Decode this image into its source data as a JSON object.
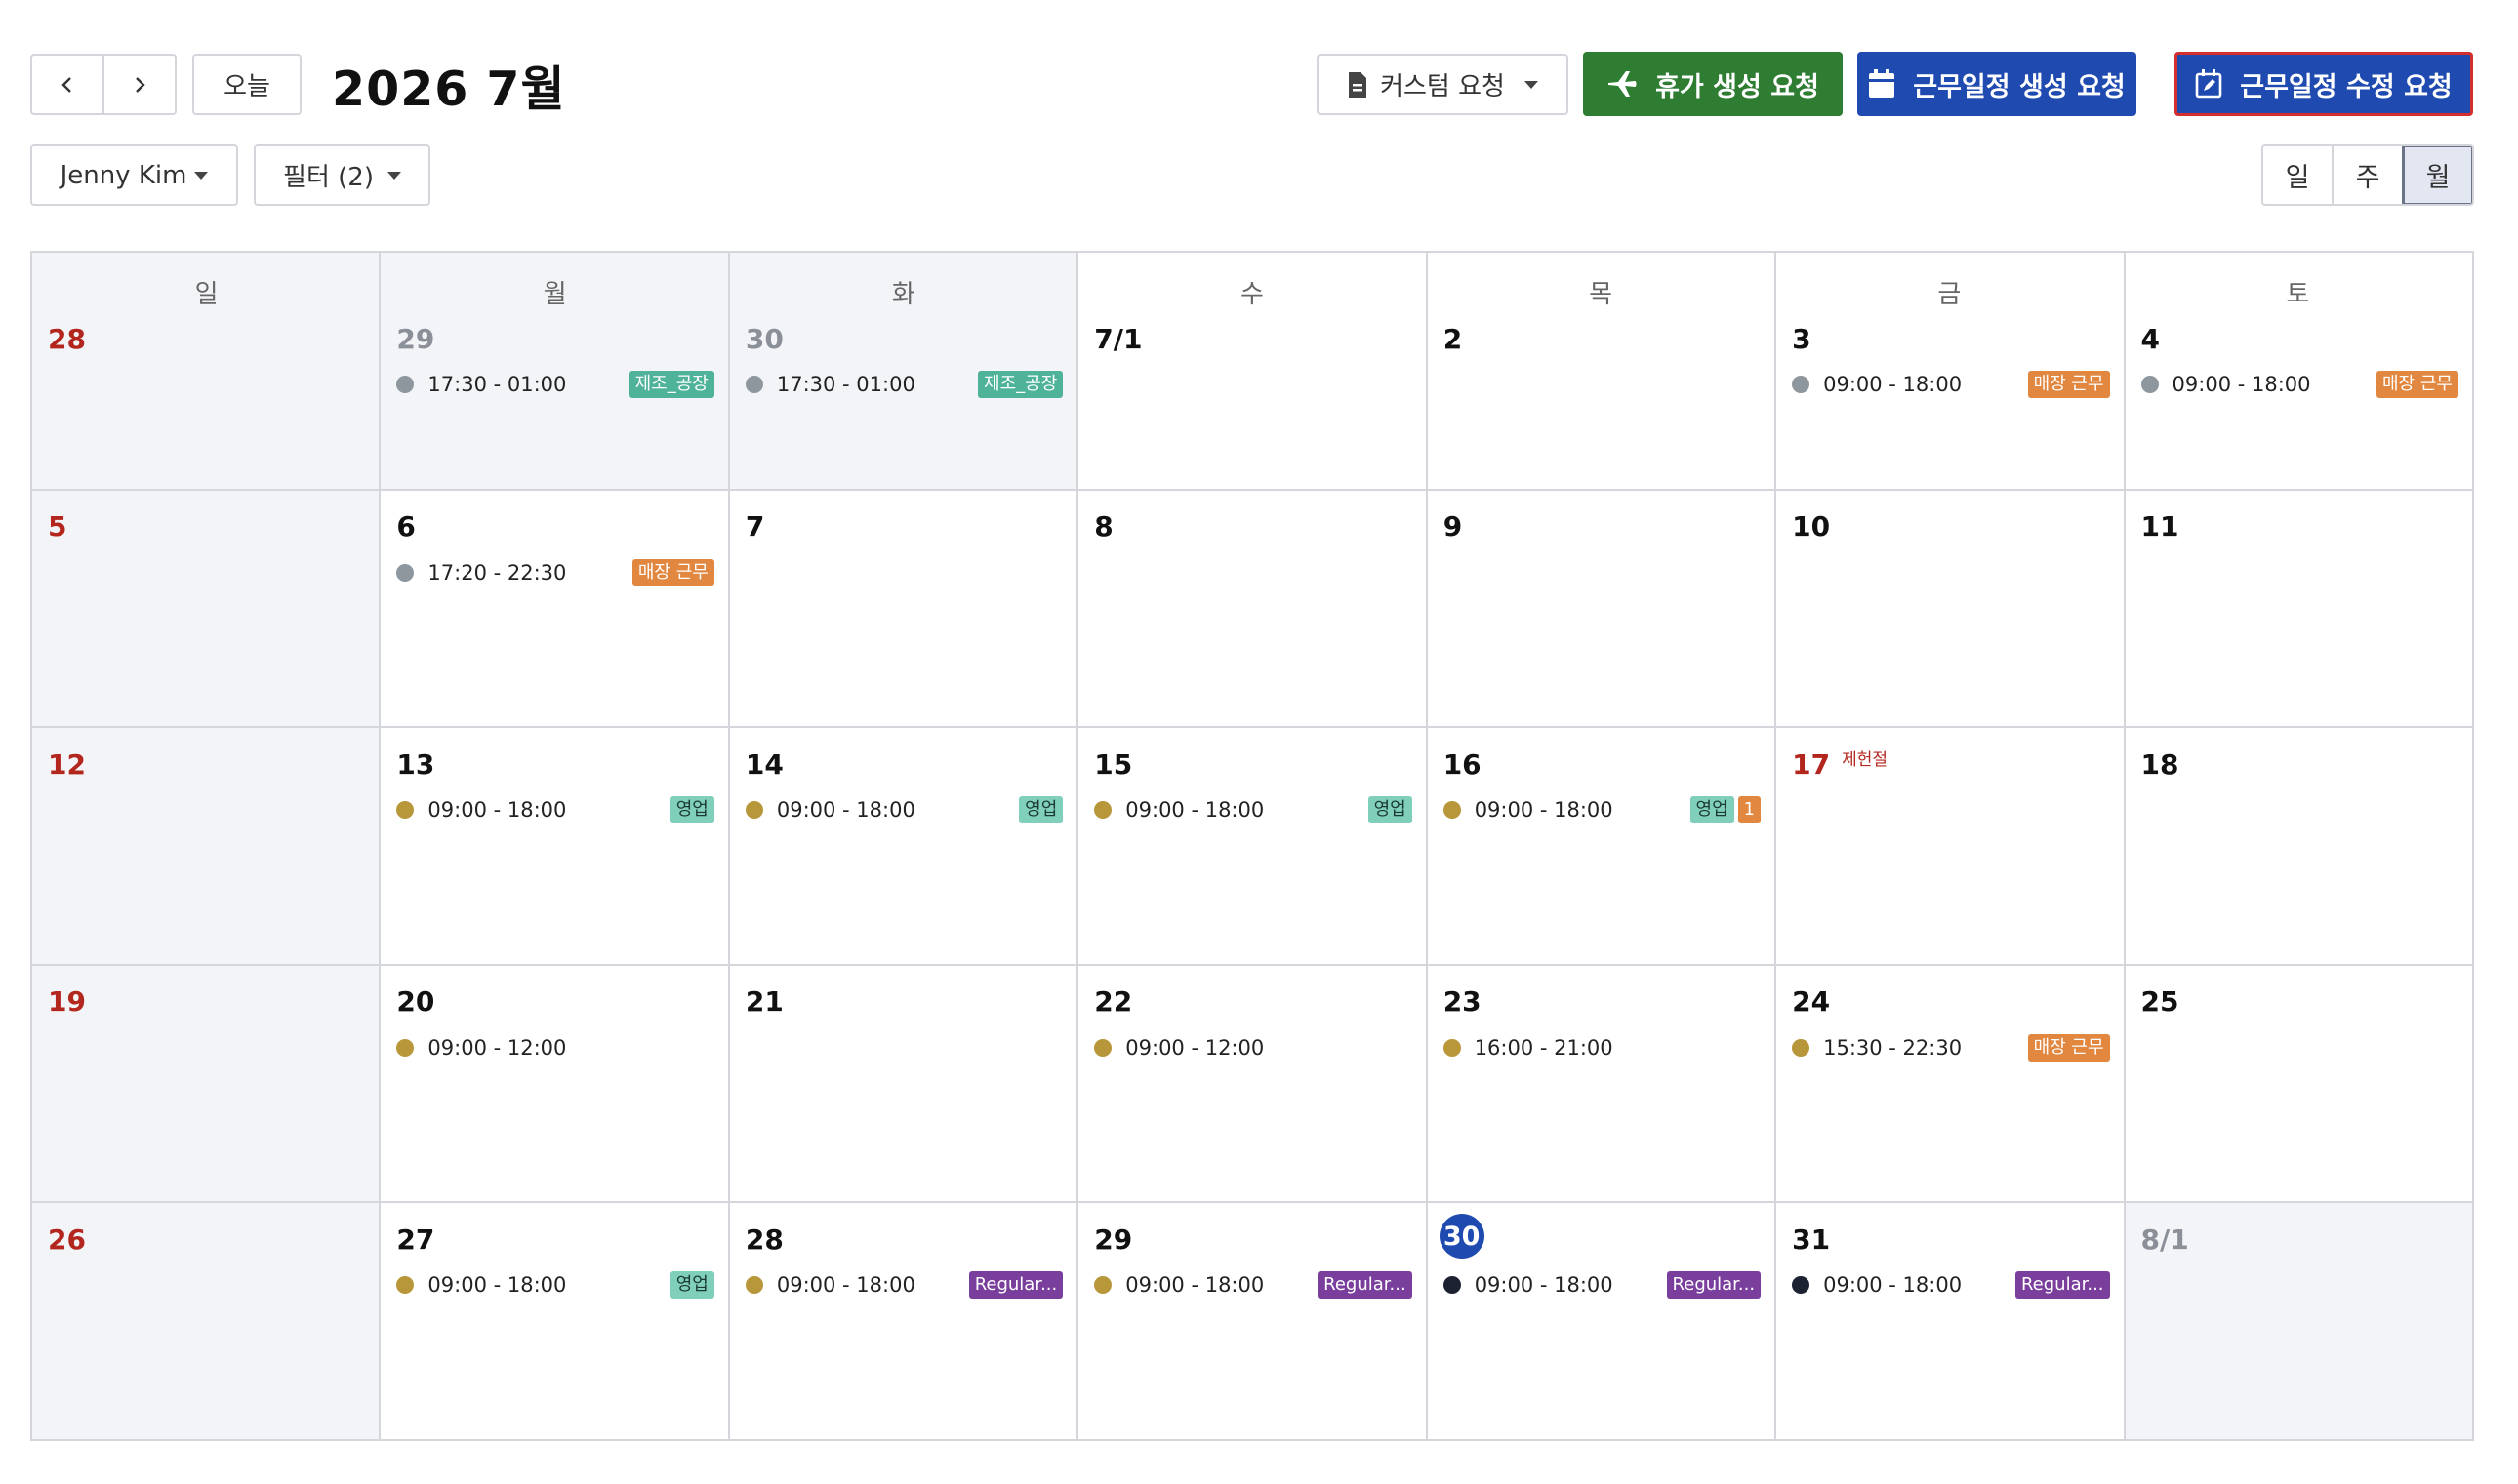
{
  "toolbar": {
    "prev_icon": "chevron-left-icon",
    "next_icon": "chevron-right-icon",
    "today_label": "오늘",
    "month_title": "2026 7월",
    "custom_request_label": "커스텀 요청",
    "vacation_label": "휴가 생성 요청",
    "schedule_create_label": "근무일정 생성 요청",
    "schedule_edit_label": "근무일정 수정 요청",
    "user_filter_label": "Jenny Kim",
    "filter_label": "필터 (2)",
    "colors": {
      "vacation": "#2e7d32",
      "create": "#1f4ab0",
      "edit": "#1f4ab0",
      "edit_border": "#d32f2f"
    }
  },
  "views": {
    "day": "일",
    "week": "주",
    "month": "월",
    "active": "month"
  },
  "calendar": {
    "weekdays": [
      "일",
      "월",
      "화",
      "수",
      "목",
      "금",
      "토"
    ],
    "weeks": [
      [
        {
          "label": "28",
          "type": "sun",
          "events": []
        },
        {
          "label": "29",
          "type": "muted",
          "events": [
            {
              "time": "17:30 - 01:00",
              "dot": "#8e979e",
              "tags": [
                {
                  "text": "제조_공장",
                  "style": "teal"
                }
              ]
            }
          ]
        },
        {
          "label": "30",
          "type": "muted",
          "events": [
            {
              "time": "17:30 - 01:00",
              "dot": "#8e979e",
              "tags": [
                {
                  "text": "제조_공장",
                  "style": "teal"
                }
              ]
            }
          ]
        },
        {
          "label": "7/1",
          "type": "",
          "events": []
        },
        {
          "label": "2",
          "type": "",
          "events": []
        },
        {
          "label": "3",
          "type": "",
          "events": [
            {
              "time": "09:00 - 18:00",
              "dot": "#8e979e",
              "tags": [
                {
                  "text": "매장 근무",
                  "style": "orange"
                }
              ]
            }
          ]
        },
        {
          "label": "4",
          "type": "",
          "events": [
            {
              "time": "09:00 - 18:00",
              "dot": "#8e979e",
              "tags": [
                {
                  "text": "매장 근무",
                  "style": "orange"
                }
              ]
            }
          ]
        }
      ],
      [
        {
          "label": "5",
          "type": "sun",
          "events": []
        },
        {
          "label": "6",
          "type": "",
          "events": [
            {
              "time": "17:20 - 22:30",
              "dot": "#8e979e",
              "tags": [
                {
                  "text": "매장 근무",
                  "style": "orange"
                }
              ]
            }
          ]
        },
        {
          "label": "7",
          "type": "",
          "events": []
        },
        {
          "label": "8",
          "type": "",
          "events": []
        },
        {
          "label": "9",
          "type": "",
          "events": []
        },
        {
          "label": "10",
          "type": "",
          "events": []
        },
        {
          "label": "11",
          "type": "",
          "events": []
        }
      ],
      [
        {
          "label": "12",
          "type": "sun",
          "events": []
        },
        {
          "label": "13",
          "type": "",
          "events": [
            {
              "time": "09:00 - 18:00",
              "dot": "#b8973a",
              "tags": [
                {
                  "text": "영업",
                  "style": "mint"
                }
              ]
            }
          ]
        },
        {
          "label": "14",
          "type": "",
          "events": [
            {
              "time": "09:00 - 18:00",
              "dot": "#b8973a",
              "tags": [
                {
                  "text": "영업",
                  "style": "mint"
                }
              ]
            }
          ]
        },
        {
          "label": "15",
          "type": "",
          "events": [
            {
              "time": "09:00 - 18:00",
              "dot": "#b8973a",
              "tags": [
                {
                  "text": "영업",
                  "style": "mint"
                }
              ]
            }
          ]
        },
        {
          "label": "16",
          "type": "",
          "events": [
            {
              "time": "09:00 - 18:00",
              "dot": "#b8973a",
              "tags": [
                {
                  "text": "영업",
                  "style": "mint"
                },
                {
                  "text": "1",
                  "style": "orange"
                }
              ]
            }
          ]
        },
        {
          "label": "17",
          "type": "sun",
          "holiday": "제헌절",
          "events": []
        },
        {
          "label": "18",
          "type": "",
          "events": []
        }
      ],
      [
        {
          "label": "19",
          "type": "sun",
          "events": []
        },
        {
          "label": "20",
          "type": "",
          "events": [
            {
              "time": "09:00 - 12:00",
              "dot": "#b8973a",
              "tags": []
            }
          ]
        },
        {
          "label": "21",
          "type": "",
          "events": []
        },
        {
          "label": "22",
          "type": "",
          "events": [
            {
              "time": "09:00 - 12:00",
              "dot": "#b8973a",
              "tags": []
            }
          ]
        },
        {
          "label": "23",
          "type": "",
          "events": [
            {
              "time": "16:00 - 21:00",
              "dot": "#b8973a",
              "tags": []
            }
          ]
        },
        {
          "label": "24",
          "type": "",
          "events": [
            {
              "time": "15:30 - 22:30",
              "dot": "#b8973a",
              "tags": [
                {
                  "text": "매장 근무",
                  "style": "orange"
                }
              ]
            }
          ]
        },
        {
          "label": "25",
          "type": "",
          "events": []
        }
      ],
      [
        {
          "label": "26",
          "type": "sun",
          "events": []
        },
        {
          "label": "27",
          "type": "",
          "events": [
            {
              "time": "09:00 - 18:00",
              "dot": "#b8973a",
              "tags": [
                {
                  "text": "영업",
                  "style": "mint"
                }
              ]
            }
          ]
        },
        {
          "label": "28",
          "type": "",
          "events": [
            {
              "time": "09:00 - 18:00",
              "dot": "#b8973a",
              "tags": [
                {
                  "text": "Regular...",
                  "style": "purple"
                }
              ]
            }
          ]
        },
        {
          "label": "29",
          "type": "",
          "events": [
            {
              "time": "09:00 - 18:00",
              "dot": "#b8973a",
              "tags": [
                {
                  "text": "Regular...",
                  "style": "purple"
                }
              ]
            }
          ]
        },
        {
          "label": "30",
          "type": "today",
          "events": [
            {
              "time": "09:00 - 18:00",
              "dot": "#1d2233",
              "tags": [
                {
                  "text": "Regular...",
                  "style": "purple"
                }
              ]
            }
          ]
        },
        {
          "label": "31",
          "type": "",
          "events": [
            {
              "time": "09:00 - 18:00",
              "dot": "#1d2233",
              "tags": [
                {
                  "text": "Regular...",
                  "style": "purple"
                }
              ]
            }
          ]
        },
        {
          "label": "8/1",
          "type": "muted",
          "events": []
        }
      ]
    ]
  }
}
